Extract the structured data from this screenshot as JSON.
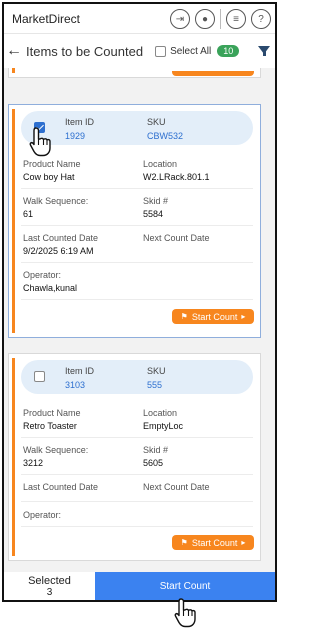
{
  "app": {
    "title": "MarketDirect"
  },
  "appbar_icons": [
    "sign-in-icon",
    "user-icon",
    "list-icon",
    "help-icon"
  ],
  "header": {
    "title": "Items to be Counted",
    "select_all_label": "Select All",
    "count_badge": "10"
  },
  "cards": [
    {
      "selected": true,
      "item_id_label": "Item ID",
      "item_id": "1929",
      "sku_label": "SKU",
      "sku": "CBW532",
      "product_name_label": "Product Name",
      "product_name": "Cow boy Hat",
      "location_label": "Location",
      "location": "W2.LRack.801.1",
      "walk_sequence_label": "Walk Sequence:",
      "walk_sequence": "61",
      "skid_label": "Skid #",
      "skid": "5584",
      "last_counted_label": "Last Counted Date",
      "last_counted": "9/2/2025 6:19 AM",
      "next_count_label": "Next Count Date",
      "next_count": "",
      "operator_label": "Operator:",
      "operator": "Chawla,kunal",
      "start_label": "Start Count"
    },
    {
      "selected": false,
      "item_id_label": "Item ID",
      "item_id": "3103",
      "sku_label": "SKU",
      "sku": "555",
      "product_name_label": "Product Name",
      "product_name": "Retro Toaster",
      "location_label": "Location",
      "location": "EmptyLoc",
      "walk_sequence_label": "Walk Sequence:",
      "walk_sequence": "3212",
      "skid_label": "Skid #",
      "skid": "5605",
      "last_counted_label": "Last Counted Date",
      "last_counted": "",
      "next_count_label": "Next Count Date",
      "next_count": "",
      "operator_label": "Operator:",
      "operator": "",
      "start_label": "Start Count"
    }
  ],
  "footer": {
    "selected_label": "Selected",
    "selected_count": "3",
    "start_count_label": "Start Count"
  },
  "colors": {
    "accent_orange": "#f7861e",
    "primary_blue": "#3b82f0",
    "link_blue": "#2d6fcf",
    "badge_green": "#3aa35a"
  }
}
